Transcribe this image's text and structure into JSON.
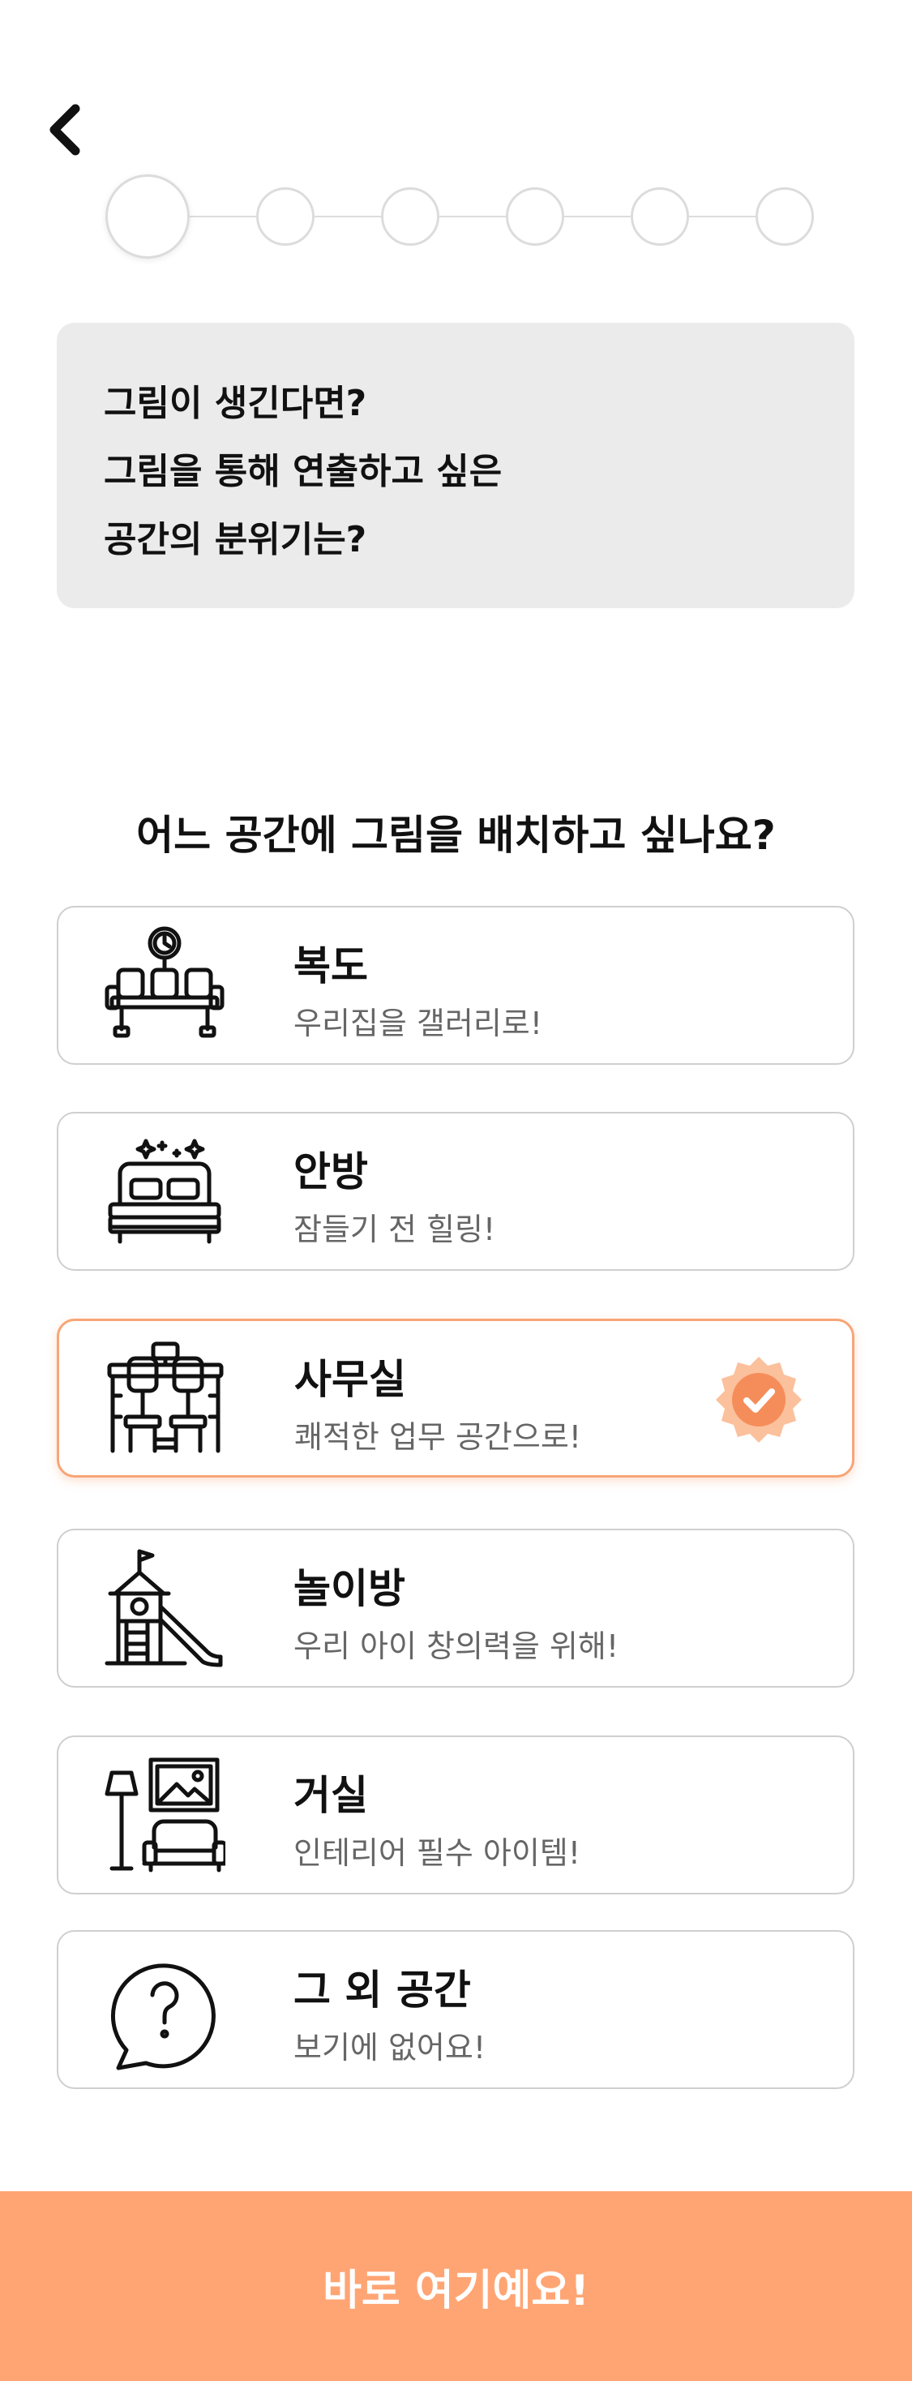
{
  "header": {
    "back_icon": "chevron-left-icon"
  },
  "stepper": {
    "total_steps": 6,
    "current_step": 1
  },
  "intro": {
    "lines": [
      "그림이 생긴다면?",
      "그림을 통해 연출하고 싶은",
      "공간의 분위기는?"
    ]
  },
  "question": "어느 공간에 그림을 배치하고 싶나요?",
  "options": [
    {
      "title": "복도",
      "desc": "우리집을 갤러리로!",
      "icon": "hallway-bench-clock-icon",
      "selected": false
    },
    {
      "title": "안방",
      "desc": "잠들기 전 힐링!",
      "icon": "bed-icon",
      "selected": false
    },
    {
      "title": "사무실",
      "desc": "쾌적한 업무 공간으로!",
      "icon": "office-desk-chairs-icon",
      "selected": true
    },
    {
      "title": "놀이방",
      "desc": "우리 아이 창의력을 위해!",
      "icon": "playground-slide-icon",
      "selected": false
    },
    {
      "title": "거실",
      "desc": "인테리어 필수 아이템!",
      "icon": "living-room-sofa-lamp-icon",
      "selected": false
    },
    {
      "title": "그 외 공간",
      "desc": "보기에 없어요!",
      "icon": "question-bubble-icon",
      "selected": false
    }
  ],
  "cta": {
    "label": "바로 여기예요!"
  },
  "colors": {
    "accent": "#ffa574",
    "selected_border": "#f7a577",
    "info_bg": "#ebebeb"
  }
}
